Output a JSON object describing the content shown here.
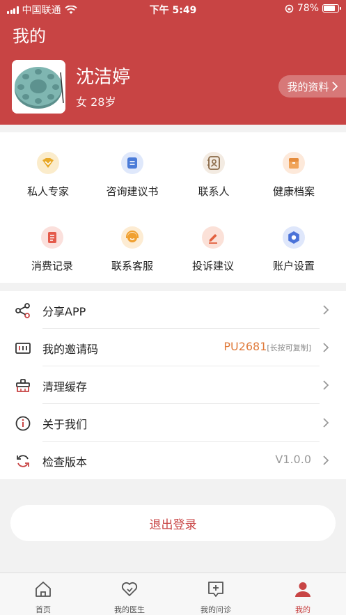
{
  "status_bar": {
    "carrier": "中国联通",
    "time": "下午 5:49",
    "battery": "78%"
  },
  "header": {
    "title": "我的",
    "user": {
      "name": "沈洁婷",
      "meta": "女 28岁"
    },
    "profile_button": "我的资料"
  },
  "grid": [
    {
      "label": "私人专家",
      "icon": "crown-icon",
      "color": "#e8a928"
    },
    {
      "label": "咨询建议书",
      "icon": "document-icon",
      "color": "#4a7bd8"
    },
    {
      "label": "联系人",
      "icon": "contacts-icon",
      "color": "#8a6a48"
    },
    {
      "label": "健康档案",
      "icon": "folder-icon",
      "color": "#f0a45a"
    },
    {
      "label": "消费记录",
      "icon": "receipt-icon",
      "color": "#e45a4a"
    },
    {
      "label": "联系客服",
      "icon": "headset-icon",
      "color": "#f0a030"
    },
    {
      "label": "投诉建议",
      "icon": "pen-icon",
      "color": "#e2603e"
    },
    {
      "label": "账户设置",
      "icon": "settings-icon",
      "color": "#4a72d8"
    }
  ],
  "list": [
    {
      "label": "分享APP",
      "icon": "share-icon"
    },
    {
      "label": "我的邀请码",
      "icon": "invite-code-icon",
      "value": "PU2681",
      "hint": "[长按可复制]"
    },
    {
      "label": "清理缓存",
      "icon": "broom-icon"
    },
    {
      "label": "关于我们",
      "icon": "info-icon"
    },
    {
      "label": "检查版本",
      "icon": "refresh-icon",
      "value": "V1.0.0"
    }
  ],
  "logout_label": "退出登录",
  "tabs": [
    {
      "label": "首页",
      "icon": "home-icon"
    },
    {
      "label": "我的医生",
      "icon": "heart-icon"
    },
    {
      "label": "我的问诊",
      "icon": "consult-icon"
    },
    {
      "label": "我的",
      "icon": "user-icon",
      "active": true
    }
  ],
  "colors": {
    "brand": "#c84444",
    "accent_value": "#e07b3c",
    "background": "#f2f2f2"
  }
}
